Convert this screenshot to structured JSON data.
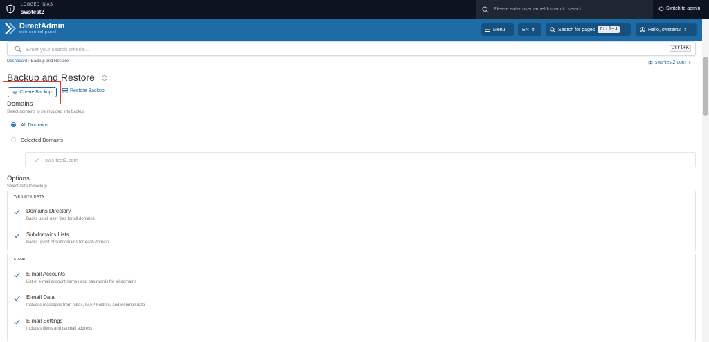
{
  "topbar": {
    "logged_label": "LOGGED IN AS",
    "user": "swstest2",
    "impersonate_placeholder": "Please enter username/domain to search",
    "switch_label": "Switch to admin"
  },
  "header": {
    "brand_name": "DirectAdmin",
    "brand_sub": "web control panel",
    "menu_label": "Menu",
    "lang_label": "EN",
    "search_label": "Search for pages",
    "search_shortcut": "Ctrl+J",
    "hello_label": "Hello, swstest2",
    "accent": "#1e6ca7"
  },
  "criteria": {
    "placeholder": "Enter your search criteria...",
    "shortcut": "Ctrl+K"
  },
  "breadcrumb": {
    "root": "Dashboard",
    "current": "Backup and Restore"
  },
  "domain_selector": "sws-test2.com",
  "page": {
    "title": "Backup and Restore",
    "create_label": "Create Backup",
    "restore_label": "Restore Backup"
  },
  "domains": {
    "title": "Domains",
    "subtitle": "Select domains to be included into backup",
    "all_label": "All Domains",
    "selected_label": "Selected Domains",
    "selected_radio": "All Domains",
    "list": [
      "sws-test2.com"
    ]
  },
  "options": {
    "title": "Options",
    "subtitle": "Select data to backup",
    "groups": [
      {
        "head": "WEBSITE DATA",
        "items": [
          {
            "name": "Domains Directory",
            "desc": "Backs up all user files for all domains",
            "checked": true
          },
          {
            "name": "Subdomains Lists",
            "desc": "Backs up list of subdomains for each domain",
            "checked": true
          }
        ]
      },
      {
        "head": "E-MAIL",
        "items": [
          {
            "name": "E-mail Accounts",
            "desc": "List of e-mail account names and passwords for all domains",
            "checked": true
          },
          {
            "name": "E-mail Data",
            "desc": "Includes messages from Inbox, IMAP Folders, and webmail data",
            "checked": true
          },
          {
            "name": "E-mail Settings",
            "desc": "Includes filters and catchall address",
            "checked": true
          }
        ]
      }
    ]
  },
  "icons": {
    "shield": "shield-icon",
    "search": "search-icon",
    "switch": "power-icon",
    "logo": "directadmin-logo-icon",
    "menu": "hamburger-icon",
    "chevron": "chevron-updown-icon",
    "user": "user-circle-icon",
    "globe": "globe-icon",
    "help": "help-circle-icon",
    "create": "gear-icon",
    "restore": "archive-icon",
    "check": "check-icon"
  },
  "colors": {
    "topbar": "#0c1421",
    "header": "#1e6ca7",
    "link": "#1e6ca7",
    "highlight": "#e53935"
  }
}
